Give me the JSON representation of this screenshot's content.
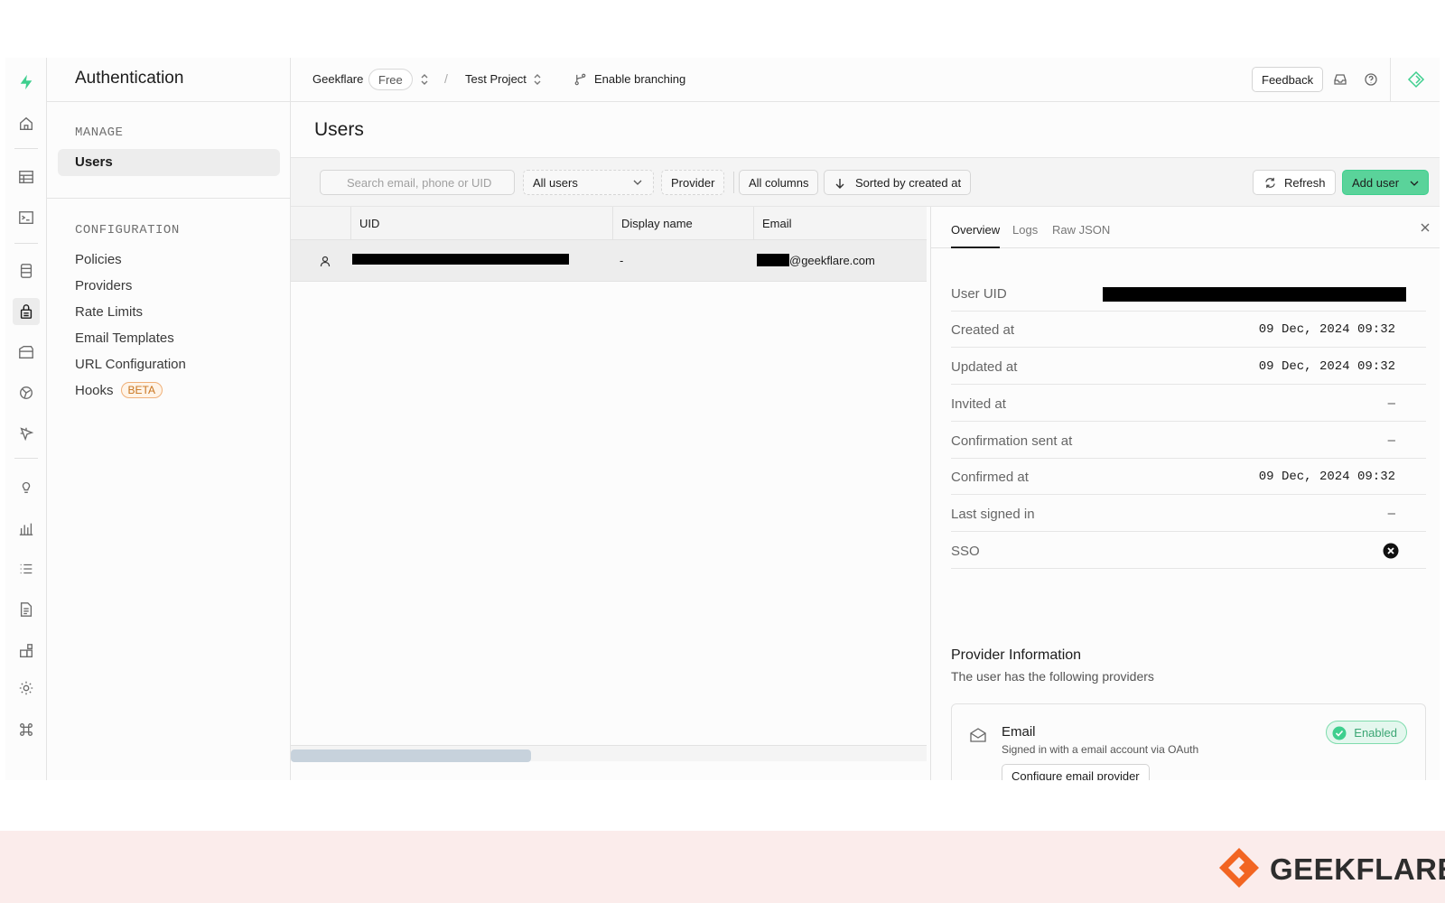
{
  "sidebar": {
    "title": "Authentication",
    "manage_label": "MANAGE",
    "manage_items": [
      "Users"
    ],
    "config_label": "CONFIGURATION",
    "config_items": [
      "Policies",
      "Providers",
      "Rate Limits",
      "Email Templates",
      "URL Configuration",
      "Hooks"
    ],
    "hooks_badge": "BETA"
  },
  "rail_icons": [
    "supabase-logo-icon",
    "home-icon",
    "table-editor-icon",
    "sql-editor-icon",
    "database-icon",
    "auth-lock-icon",
    "storage-icon",
    "realtime-icon",
    "edge-functions-icon",
    "advisors-bulb-icon",
    "reports-icon",
    "logs-list-icon",
    "api-docs-icon",
    "integrations-icon",
    "settings-gear-icon",
    "command-icon"
  ],
  "topbar": {
    "org": "Geekflare",
    "plan": "Free",
    "separator": "/",
    "project": "Test Project",
    "branching": "Enable branching",
    "feedback": "Feedback"
  },
  "page": {
    "title": "Users"
  },
  "toolbar": {
    "search_placeholder": "Search email, phone or UID",
    "filter": "All users",
    "provider": "Provider",
    "columns": "All columns",
    "sort": "Sorted by created at",
    "refresh": "Refresh",
    "add_user": "Add user"
  },
  "grid": {
    "columns": [
      "UID",
      "Display name",
      "Email"
    ],
    "rows": [
      {
        "display_name": "-",
        "email_domain": "@geekflare.com"
      }
    ]
  },
  "panel": {
    "tabs": [
      "Overview",
      "Logs",
      "Raw JSON"
    ],
    "fields": [
      {
        "label": "User UID",
        "value": ""
      },
      {
        "label": "Created at",
        "value": "09 Dec, 2024 09:32"
      },
      {
        "label": "Updated at",
        "value": "09 Dec, 2024 09:32"
      },
      {
        "label": "Invited at",
        "value": "–"
      },
      {
        "label": "Confirmation sent at",
        "value": "–"
      },
      {
        "label": "Confirmed at",
        "value": "09 Dec, 2024 09:32"
      },
      {
        "label": "Last signed in",
        "value": "–"
      },
      {
        "label": "SSO",
        "value": ""
      }
    ],
    "provider_title": "Provider Information",
    "provider_subtitle": "The user has the following providers",
    "provider": {
      "name": "Email",
      "description": "Signed in with a email account via OAuth",
      "status": "Enabled",
      "configure": "Configure email provider"
    }
  },
  "footer": {
    "brand": "GEEKFLARE"
  },
  "colors": {
    "accent": "#3ecf8e",
    "brand_orange": "#f26522",
    "beta": "#c8741e"
  }
}
